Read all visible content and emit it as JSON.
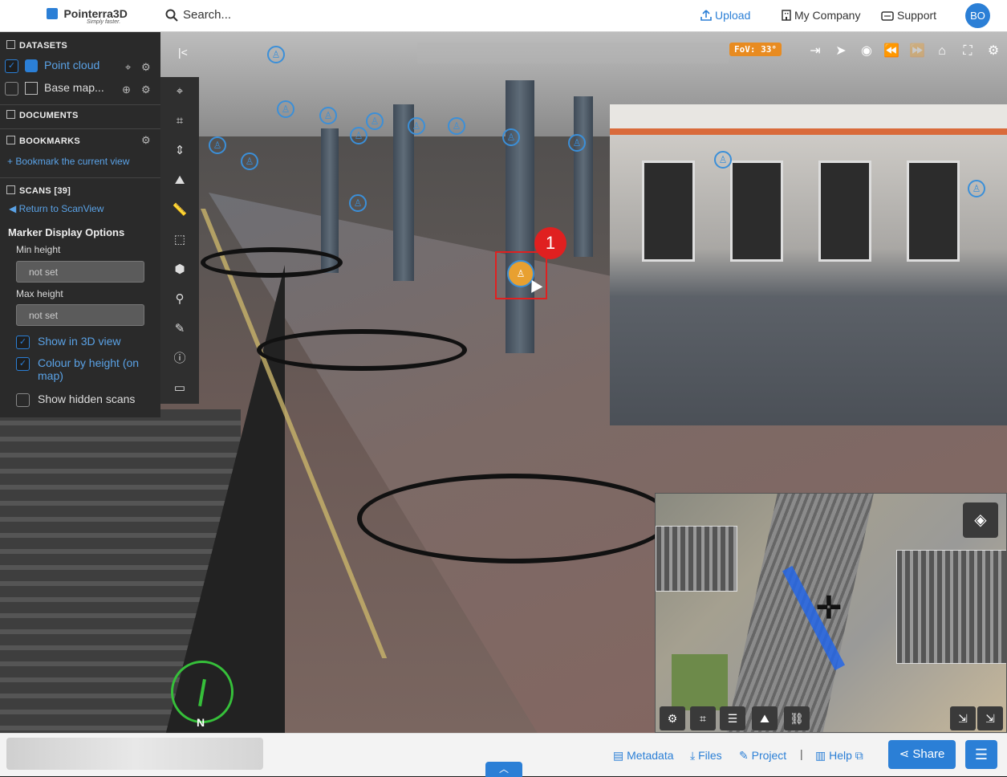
{
  "app": {
    "brand": "Pointerra3D",
    "tagline": "Simply faster."
  },
  "header": {
    "search_placeholder": "Search...",
    "upload": "Upload",
    "company": "My Company",
    "support": "Support",
    "avatar_initials": "BO"
  },
  "sidebar": {
    "datasets": {
      "title": "DATASETS",
      "items": [
        {
          "label": "Point cloud",
          "checked": true
        },
        {
          "label": "Base map...",
          "checked": false
        }
      ]
    },
    "documents": {
      "title": "DOCUMENTS"
    },
    "bookmarks": {
      "title": "BOOKMARKS",
      "add_link": "+ Bookmark the current view"
    },
    "scans": {
      "title": "SCANS [39]",
      "return_link": "Return to ScanView",
      "options_title": "Marker Display Options",
      "min_height_label": "Min height",
      "min_height_value": "not set",
      "max_height_label": "Max height",
      "max_height_value": "not set",
      "show_3d": {
        "label": "Show in 3D view",
        "checked": true
      },
      "colour_by_height": {
        "label": "Colour by height (on map)",
        "checked": true
      },
      "show_hidden": {
        "label": "Show hidden scans",
        "checked": false
      }
    }
  },
  "viewer": {
    "fov": "FoV: 33°",
    "step_badge": "1",
    "compass_north": "N",
    "colors": {
      "accent": "#2b7fd6",
      "fov_bg": "#e88b20",
      "highlight": "#e02020",
      "compass": "#36c03a"
    }
  },
  "footer": {
    "metadata": "Metadata",
    "files": "Files",
    "project": "Project",
    "separator": "|",
    "help": "Help",
    "share": "Share"
  }
}
